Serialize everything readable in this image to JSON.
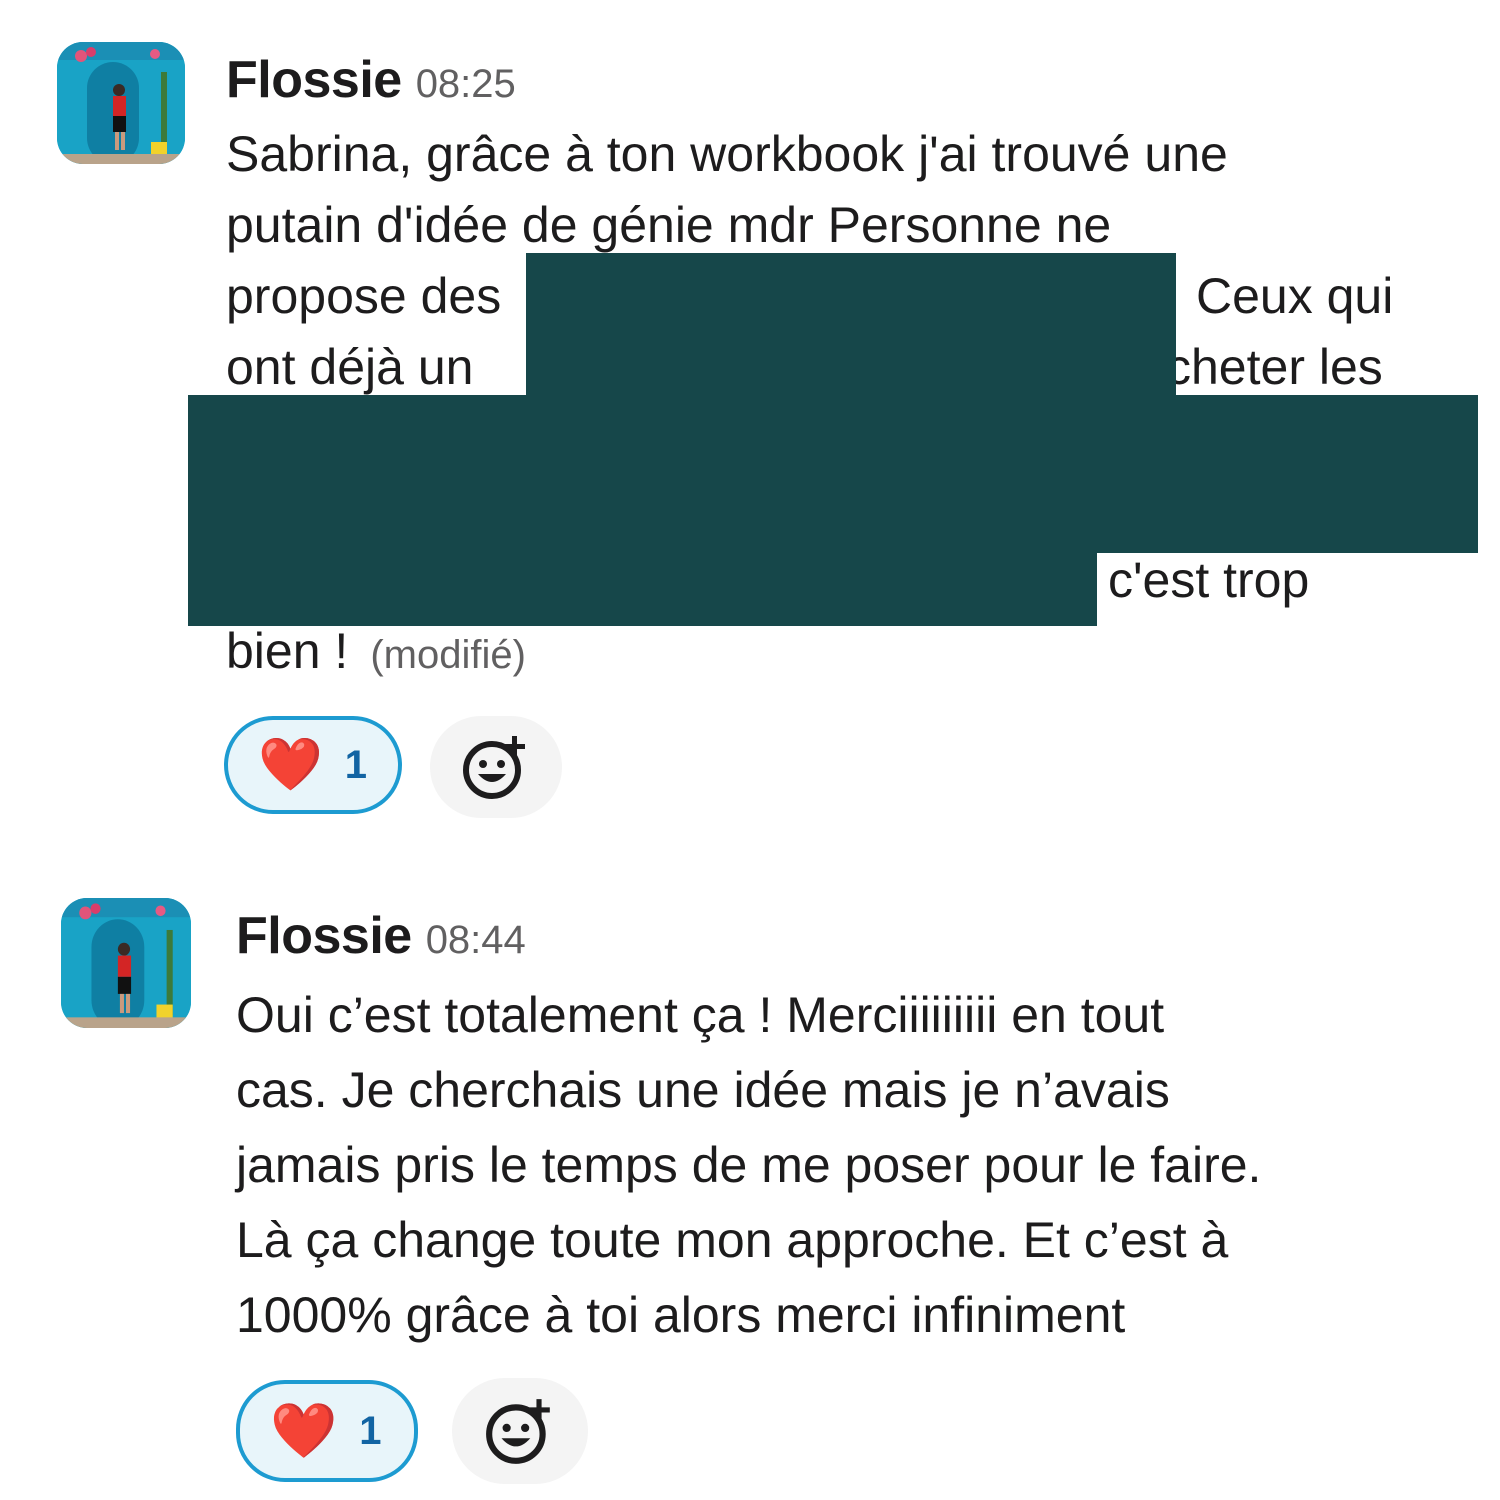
{
  "messages": [
    {
      "author": "Flossie",
      "time": "08:25",
      "lines": [
        "Sabrina, grâce à ton workbook j'ai trouvé une",
        "putain d'idée de génie mdr Personne ne",
        "propose des",
        "Ceux qui",
        "ont déjà un",
        "cheter les",
        "c'est trop",
        "bien !"
      ],
      "edited_label": "(modifié)",
      "reaction": {
        "emoji": "❤️",
        "count": "1"
      }
    },
    {
      "author": "Flossie",
      "time": "08:44",
      "lines": [
        "Oui c’est totalement ça ! Merciiiiiiiii en tout",
        "cas. Je cherchais une idée mais je n’avais",
        "jamais pris le temps de me poser pour le faire.",
        "Là ça change toute mon approche. Et c’est à",
        "1000% grâce à toi alors merci infiniment"
      ],
      "reaction": {
        "emoji": "❤️",
        "count": "1"
      }
    }
  ],
  "icons": {
    "avatar": "avatar-photo",
    "add_reaction": "add-reaction-icon",
    "heart": "heart-emoji"
  },
  "colors": {
    "redaction": "#16474a",
    "reaction_border": "#1d9bd1",
    "reaction_count": "#1264a3"
  }
}
